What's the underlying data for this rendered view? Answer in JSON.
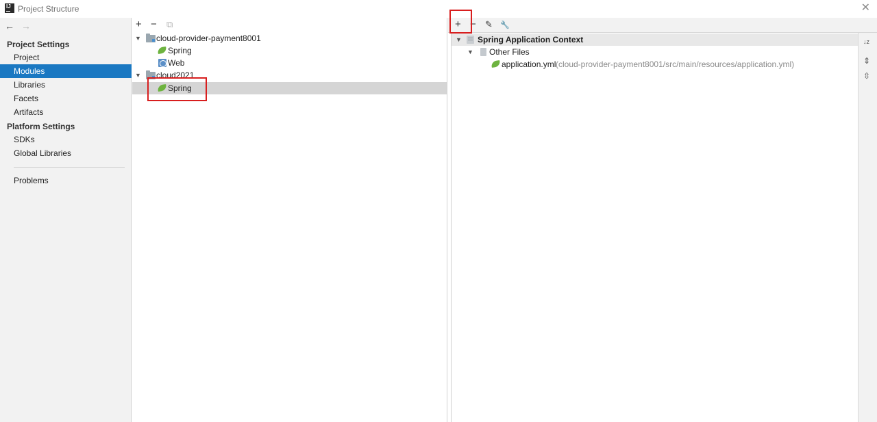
{
  "window": {
    "title": "Project Structure",
    "logo_text": "IJ",
    "close_glyph": "✕"
  },
  "sidebar": {
    "back_glyph": "←",
    "forward_glyph": "→",
    "project_settings_header": "Project Settings",
    "project_settings_items": [
      {
        "label": "Project",
        "selected": false
      },
      {
        "label": "Modules",
        "selected": true
      },
      {
        "label": "Libraries",
        "selected": false
      },
      {
        "label": "Facets",
        "selected": false
      },
      {
        "label": "Artifacts",
        "selected": false
      }
    ],
    "platform_settings_header": "Platform Settings",
    "platform_settings_items": [
      {
        "label": "SDKs"
      },
      {
        "label": "Global Libraries"
      }
    ],
    "problems_label": "Problems"
  },
  "module_tree": {
    "toolbar": {
      "add": "+",
      "remove": "−",
      "copy": "⧉"
    },
    "nodes": [
      {
        "label": "cloud-provider-payment8001",
        "icon": "module-folder-icon",
        "expanded": true
      },
      {
        "label": "Spring",
        "icon": "spring-leaf-icon"
      },
      {
        "label": "Web",
        "icon": "web-facet-icon"
      },
      {
        "label": "cloud2021",
        "icon": "module-folder-icon",
        "expanded": true
      },
      {
        "label": "Spring",
        "icon": "spring-leaf-icon",
        "selected": true
      }
    ]
  },
  "context_panel": {
    "toolbar": {
      "add": "+",
      "remove": "−",
      "edit": "✎",
      "settings": "🔧"
    },
    "header_label": "Spring Application Context",
    "group_label": "Other Files",
    "file_name": "application.yml",
    "file_path": "(cloud-provider-payment8001/src/main/resources/application.yml)",
    "side_icons": [
      {
        "name": "sort-icon",
        "glyph": "↓z"
      },
      {
        "name": "expand-all-icon",
        "glyph": "⇕"
      },
      {
        "name": "collapse-all-icon",
        "glyph": "⇳"
      }
    ]
  },
  "colors": {
    "selection_blue": "#1a78c2",
    "highlight_red": "#d81e1e",
    "spring_green": "#6db33f"
  }
}
